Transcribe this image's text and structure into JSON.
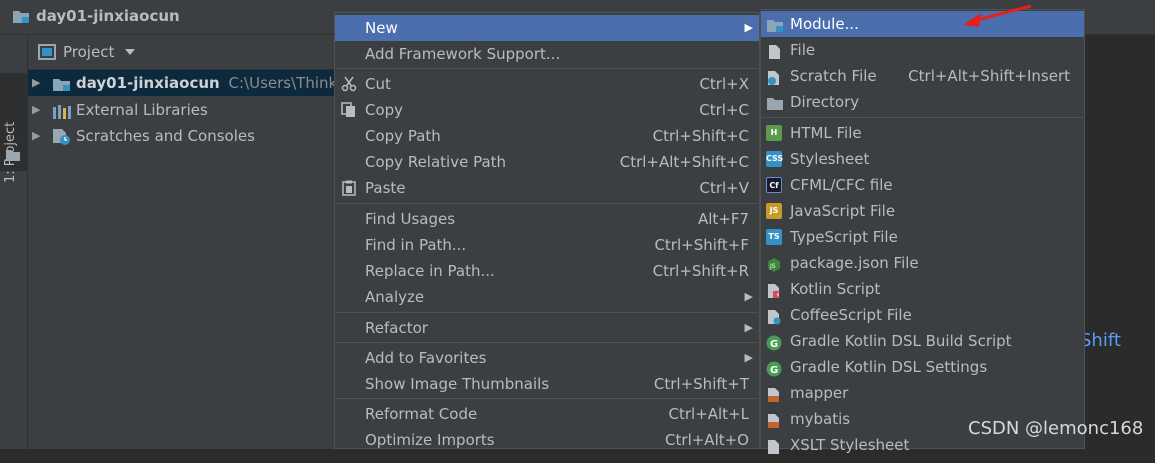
{
  "window": {
    "title": "day01-jinxiaocun"
  },
  "toolstrip": {
    "tab_label": "1: Project"
  },
  "project_panel": {
    "header": "Project",
    "tree": [
      {
        "label": "day01-jinxiaocun",
        "path": "C:\\Users\\ThinkPa",
        "selected": true
      },
      {
        "label": "External Libraries"
      },
      {
        "label": "Scratches and Consoles"
      }
    ]
  },
  "context_menu": {
    "items": [
      {
        "label": "New",
        "shortcut": "",
        "submenu": true,
        "active": true
      },
      {
        "label": "Add Framework Support...",
        "shortcut": ""
      },
      {
        "label": "Cut",
        "shortcut": "Ctrl+X",
        "icon": "scissors-icon"
      },
      {
        "label": "Copy",
        "shortcut": "Ctrl+C",
        "icon": "copy-icon"
      },
      {
        "label": "Copy Path",
        "shortcut": "Ctrl+Shift+C"
      },
      {
        "label": "Copy Relative Path",
        "shortcut": "Ctrl+Alt+Shift+C"
      },
      {
        "label": "Paste",
        "shortcut": "Ctrl+V",
        "icon": "clipboard-icon"
      },
      {
        "label": "Find Usages",
        "shortcut": "Alt+F7"
      },
      {
        "label": "Find in Path...",
        "shortcut": "Ctrl+Shift+F"
      },
      {
        "label": "Replace in Path...",
        "shortcut": "Ctrl+Shift+R"
      },
      {
        "label": "Analyze",
        "shortcut": "",
        "submenu": true
      },
      {
        "label": "Refactor",
        "shortcut": "",
        "submenu": true
      },
      {
        "label": "Add to Favorites",
        "shortcut": "",
        "submenu": true
      },
      {
        "label": "Show Image Thumbnails",
        "shortcut": "Ctrl+Shift+T"
      },
      {
        "label": "Reformat Code",
        "shortcut": "Ctrl+Alt+L"
      },
      {
        "label": "Optimize Imports",
        "shortcut": "Ctrl+Alt+O"
      }
    ]
  },
  "new_submenu": {
    "items": [
      {
        "label": "Module...",
        "shortcut": "",
        "active": true,
        "icon": "module-folder-icon"
      },
      {
        "label": "File",
        "shortcut": "",
        "icon": "file-icon"
      },
      {
        "label": "Scratch File",
        "shortcut": "Ctrl+Alt+Shift+Insert",
        "icon": "scratch-file-icon"
      },
      {
        "label": "Directory",
        "shortcut": "",
        "icon": "folder-icon"
      },
      {
        "label": "HTML File",
        "icon": "html-file-icon"
      },
      {
        "label": "Stylesheet",
        "icon": "css-file-icon"
      },
      {
        "label": "CFML/CFC file",
        "icon": "cfml-file-icon"
      },
      {
        "label": "JavaScript File",
        "icon": "javascript-file-icon"
      },
      {
        "label": "TypeScript File",
        "icon": "typescript-file-icon"
      },
      {
        "label": "package.json File",
        "icon": "nodejs-icon"
      },
      {
        "label": "Kotlin Script",
        "icon": "kotlin-script-icon"
      },
      {
        "label": "CoffeeScript File",
        "icon": "coffeescript-file-icon"
      },
      {
        "label": "Gradle Kotlin DSL Build Script",
        "icon": "gradle-icon"
      },
      {
        "label": "Gradle Kotlin DSL Settings",
        "icon": "gradle-icon"
      },
      {
        "label": "mapper",
        "icon": "xml-template-icon"
      },
      {
        "label": "mybatis",
        "icon": "xml-template-icon"
      },
      {
        "label": "XSLT Stylesheet",
        "icon": "xslt-file-icon"
      }
    ]
  },
  "editor": {
    "hint_fragment": "Shift"
  },
  "watermark": "CSDN @lemonc168",
  "colors": {
    "highlight": "#4b6eaf",
    "background": "#2b2b2b",
    "panel": "#3c3f41",
    "text": "#bbbbbb",
    "link": "#589df6",
    "arrow": "#e8201a"
  }
}
